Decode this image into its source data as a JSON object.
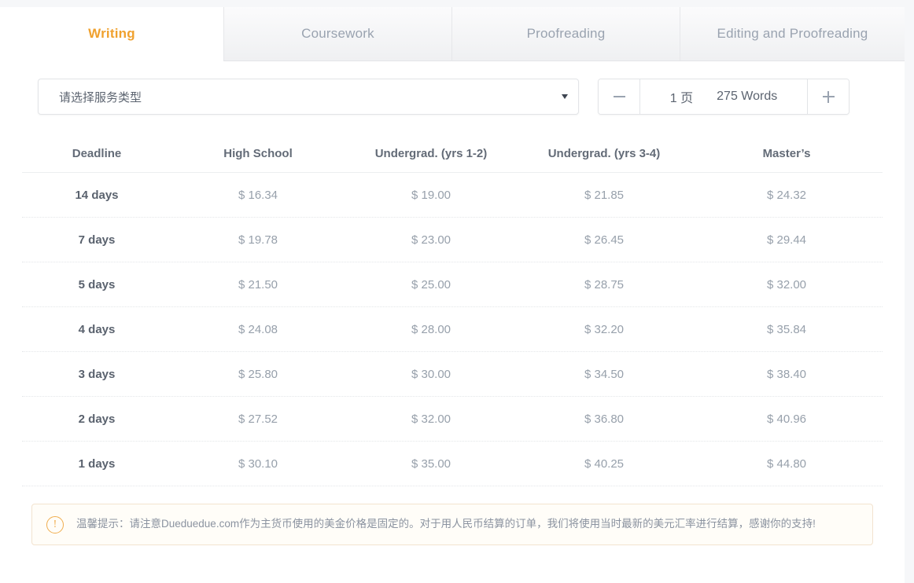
{
  "tabs": [
    {
      "label": "Writing",
      "active": true
    },
    {
      "label": "Coursework",
      "active": false
    },
    {
      "label": "Proofreading",
      "active": false
    },
    {
      "label": "Editing and Proofreading",
      "active": false
    }
  ],
  "service_select": {
    "value": "请选择服务类型",
    "caret_icon": "chevron-down-icon"
  },
  "stepper": {
    "minus_label": "−",
    "plus_label": "+",
    "pages": "1 页",
    "words": "275 Words"
  },
  "table": {
    "columns": [
      "Deadline",
      "High School",
      "Undergrad. (yrs 1-2)",
      "Undergrad. (yrs 3-4)",
      "Master’s"
    ],
    "rows": [
      [
        "14 days",
        "$ 16.34",
        "$ 19.00",
        "$ 21.85",
        "$ 24.32"
      ],
      [
        "7 days",
        "$ 19.78",
        "$ 23.00",
        "$ 26.45",
        "$ 29.44"
      ],
      [
        "5 days",
        "$ 21.50",
        "$ 25.00",
        "$ 28.75",
        "$ 32.00"
      ],
      [
        "4 days",
        "$ 24.08",
        "$ 28.00",
        "$ 32.20",
        "$ 35.84"
      ],
      [
        "3 days",
        "$ 25.80",
        "$ 30.00",
        "$ 34.50",
        "$ 38.40"
      ],
      [
        "2 days",
        "$ 27.52",
        "$ 32.00",
        "$ 36.80",
        "$ 40.96"
      ],
      [
        "1 days",
        "$ 30.10",
        "$ 35.00",
        "$ 40.25",
        "$ 44.80"
      ]
    ]
  },
  "notice": {
    "icon": "exclamation-circle-icon",
    "text": "温馨提示：请注意Dueduedue.com作为主货币使用的美金价格是固定的。对于用人民币结算的订单，我们将使用当时最新的美元汇率进行结算，感谢你的支持!"
  },
  "colors": {
    "accent": "#f0a12e",
    "tab_inactive_text": "#9aa3b0",
    "table_header_text": "#636b77",
    "price_text": "#97a0ab",
    "notice_bg": "#fffdf8",
    "notice_border": "#f2e3cf"
  }
}
